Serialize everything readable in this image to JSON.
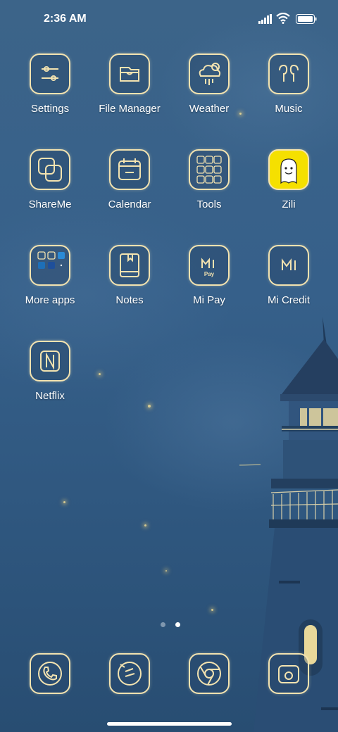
{
  "status_bar": {
    "time": "2:36 AM"
  },
  "apps": [
    {
      "label": "Settings",
      "icon": "settings-icon"
    },
    {
      "label": "File Manager",
      "icon": "folder-icon"
    },
    {
      "label": "Weather",
      "icon": "weather-icon"
    },
    {
      "label": "Music",
      "icon": "headphones-icon"
    },
    {
      "label": "ShareMe",
      "icon": "shareme-icon"
    },
    {
      "label": "Calendar",
      "icon": "calendar-icon"
    },
    {
      "label": "Tools",
      "icon": "tools-folder-icon"
    },
    {
      "label": "Zili",
      "icon": "zili-icon"
    },
    {
      "label": "More apps",
      "icon": "more-apps-folder-icon"
    },
    {
      "label": "Notes",
      "icon": "notes-icon"
    },
    {
      "label": "Mi Pay",
      "icon": "mi-pay-icon",
      "icon_text": "Pay"
    },
    {
      "label": "Mi Credit",
      "icon": "mi-credit-icon"
    },
    {
      "label": "Netflix",
      "icon": "netflix-icon"
    }
  ],
  "dock": [
    {
      "icon": "phone-icon"
    },
    {
      "icon": "messages-icon"
    },
    {
      "icon": "chrome-icon"
    },
    {
      "icon": "camera-icon"
    }
  ],
  "page_indicator": {
    "pages": 2,
    "current": 2
  },
  "colors": {
    "icon_outline": "#f3e3b0",
    "background": "#36608a",
    "zili_bg": "#f5e000"
  }
}
